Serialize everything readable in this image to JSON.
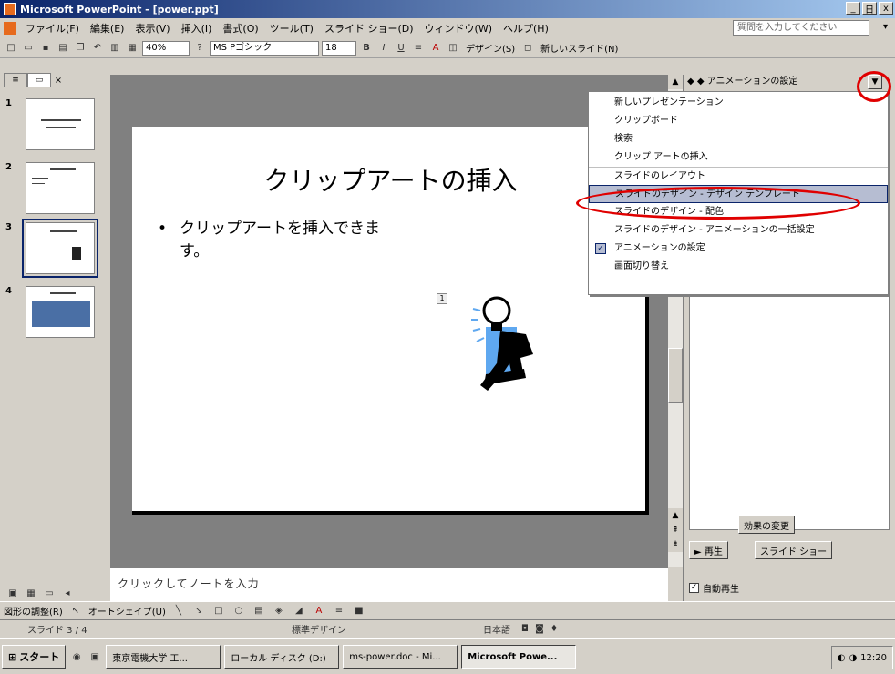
{
  "window": {
    "title": "Microsoft PowerPoint - [power.ppt]",
    "min": "_",
    "restore": "日",
    "close": "x"
  },
  "menubar": {
    "items": [
      "ファイル(F)",
      "編集(E)",
      "表示(V)",
      "挿入(I)",
      "書式(O)",
      "ツール(T)",
      "スライド ショー(D)",
      "ウィンドウ(W)",
      "ヘルプ(H)"
    ],
    "help_placeholder": "質問を入力してください"
  },
  "toolbar": {
    "zoom": "40%",
    "font": "MS Pゴシック",
    "size": "18",
    "bold": "B",
    "italic": "I",
    "underline": "U",
    "design": "デザイン(S)",
    "new_slide": "新しいスライド(N)"
  },
  "outline_tabs": [
    "アウトライン",
    "スライド"
  ],
  "thumbnails": [
    "1",
    "2",
    "3",
    "4"
  ],
  "slide": {
    "title": "クリップアートの挿入",
    "bullet": "•",
    "body": "クリップアートを挿入できます。"
  },
  "task_pane": {
    "header": "◆ ◆ アニメーションの設定",
    "dropdown_glyph": "▼",
    "change_btn": "効果の変更",
    "play_btn": "► 再生",
    "show_btn": "スライド ショー",
    "autoplay": "自動再生"
  },
  "dropdown_menu": {
    "items": [
      "新しいプレゼンテーション",
      "クリップボード",
      "検索",
      "クリップ アートの挿入",
      "スライドのレイアウト",
      "スライドのデザイン - デザイン テンプレート",
      "スライドのデザイン - 配色",
      "スライドのデザイン - アニメーションの一括設定",
      "アニメーションの設定",
      "画面切り替え"
    ],
    "highlighted_index": 5,
    "checked_index": 8
  },
  "notes": {
    "placeholder": "クリックしてノートを入力"
  },
  "drawbar": {
    "draw": "図形の調整(R)",
    "autoshapes": "オートシェイプ(U)"
  },
  "status": {
    "slide": "スライド 3 / 4",
    "design": "標準デザイン",
    "lang": "日本語"
  },
  "taskbar": {
    "start": "スタート",
    "buttons": [
      "東京電機大学 工...",
      "ローカル ディスク (D:)",
      "ms-power.doc - Mi...",
      "Microsoft Powe..."
    ],
    "clock": "12:20"
  },
  "colors": {
    "accent": "#0a246a",
    "highlight_ring": "#e00000",
    "clipart_blue": "#5fa8f0"
  }
}
